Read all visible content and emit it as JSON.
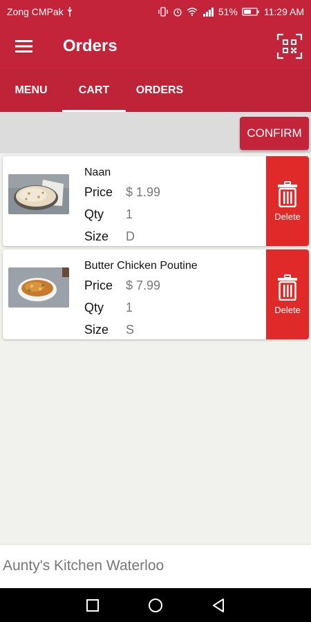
{
  "status_bar": {
    "carrier": "Zong CMPak",
    "battery": "51%",
    "time": "11:29 AM"
  },
  "app_bar": {
    "title": "Orders"
  },
  "tabs": [
    {
      "label": "MENU"
    },
    {
      "label": "CART",
      "selected": true
    },
    {
      "label": "ORDERS"
    }
  ],
  "toolbar": {
    "confirm_label": "CONFIRM"
  },
  "cart": {
    "price_label": "Price",
    "qty_label": "Qty",
    "size_label": "Size",
    "delete_label": "Delete",
    "items": [
      {
        "name": "Naan",
        "price": "$ 1.99",
        "qty": "1",
        "size": "D"
      },
      {
        "name": "Butter Chicken Poutine",
        "price": "$ 7.99",
        "qty": "1",
        "size": "S"
      }
    ]
  },
  "footer": {
    "restaurant": "Aunty's Kitchen Waterloo"
  },
  "colors": {
    "primary": "#c3243a",
    "delete": "#e02a2a",
    "background": "#f1f1ee"
  }
}
